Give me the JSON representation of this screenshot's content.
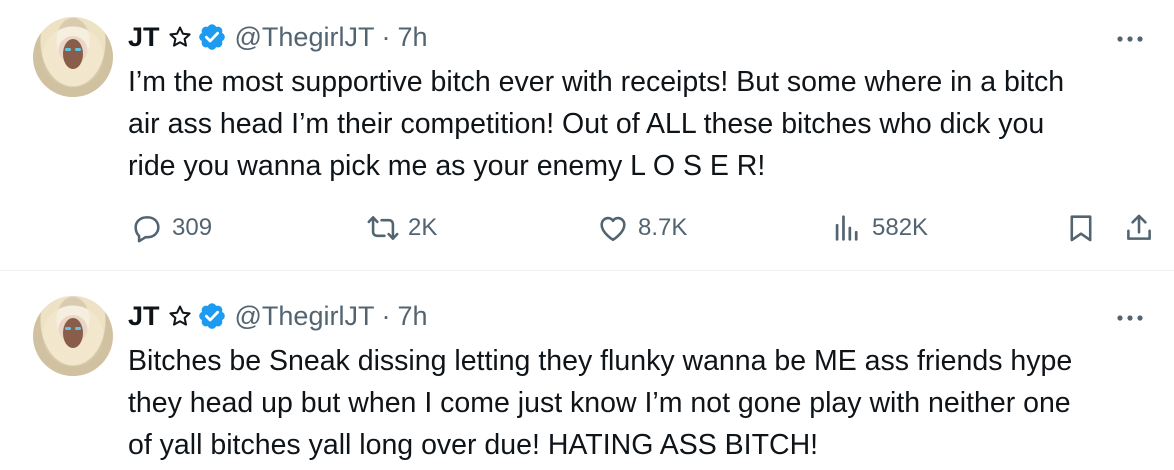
{
  "tweets": [
    {
      "name": "JT",
      "handle": "@ThegirlJT",
      "separator": "·",
      "time": "7h",
      "text": "I’m the most supportive bitch ever with receipts! But some where in a bitch\nair ass head I’m their competition! Out of ALL these bitches who dick you\nride you wanna pick me as your enemy L O S E R!",
      "replies": "309",
      "reposts": "2K",
      "likes": "8.7K",
      "views": "582K",
      "icons": [
        "star-icon",
        "verified-badge-icon",
        "more-icon",
        "reply-icon",
        "repost-icon",
        "like-icon",
        "views-icon",
        "bookmark-icon",
        "share-icon"
      ]
    },
    {
      "name": "JT",
      "handle": "@ThegirlJT",
      "separator": "·",
      "time": "7h",
      "text": "Bitches be Sneak dissing letting they flunky wanna be ME ass friends hype\nthey head up but when I come just know I’m not gone play with neither one\nof yall bitches yall long over due! HATING ASS BITCH!",
      "icons": [
        "star-icon",
        "verified-badge-icon",
        "more-icon"
      ]
    }
  ],
  "colors": {
    "text": "#0f1419",
    "secondary": "#536471",
    "verified": "#1d9bf0",
    "divider": "#eff3f4"
  }
}
